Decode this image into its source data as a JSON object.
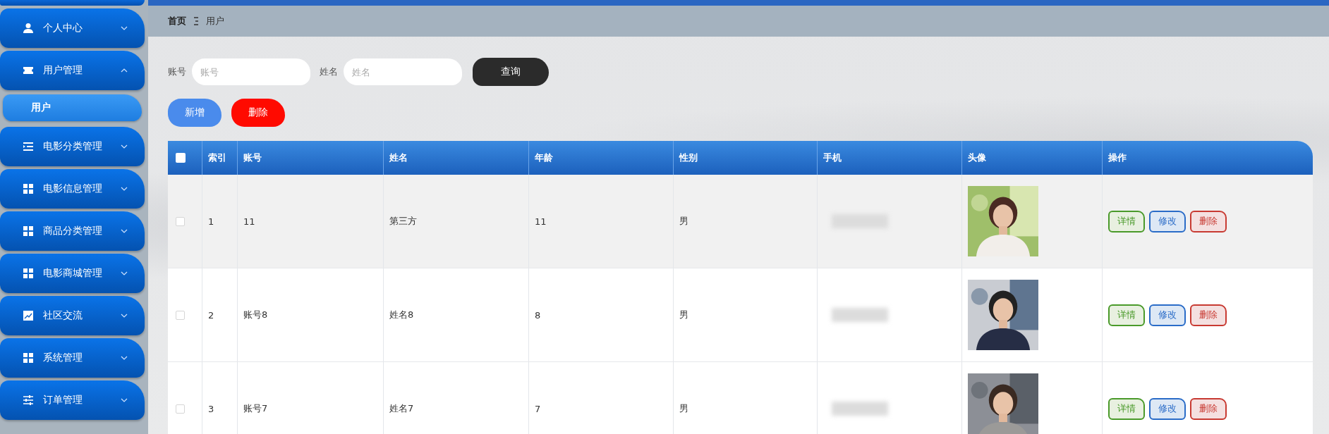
{
  "sidebar": {
    "items": [
      {
        "label": "个人中心",
        "expanded": false
      },
      {
        "label": "用户管理",
        "expanded": true,
        "children": [
          {
            "label": "用户",
            "selected": true
          }
        ]
      },
      {
        "label": "电影分类管理",
        "expanded": false
      },
      {
        "label": "电影信息管理",
        "expanded": false
      },
      {
        "label": "商品分类管理",
        "expanded": false
      },
      {
        "label": "电影商城管理",
        "expanded": false
      },
      {
        "label": "社区交流",
        "expanded": false
      },
      {
        "label": "系统管理",
        "expanded": false
      },
      {
        "label": "订单管理",
        "expanded": false
      }
    ]
  },
  "breadcrumb": [
    "首页",
    "用户"
  ],
  "search": {
    "fields": [
      {
        "label": "账号",
        "placeholder": "账号"
      },
      {
        "label": "姓名",
        "placeholder": "姓名"
      }
    ],
    "button": "查询"
  },
  "toolbar": [
    {
      "label": "新增",
      "kind": "add"
    },
    {
      "label": "删除",
      "kind": "delete"
    }
  ],
  "table": {
    "select_all": {
      "checked": false
    },
    "columns": [
      "索引",
      "账号",
      "姓名",
      "年龄",
      "性别",
      "手机",
      "头像",
      "操作"
    ],
    "rows": [
      {
        "checked": false,
        "highlighted": true,
        "index": "1",
        "account": "11",
        "name": "第三方",
        "age": "11",
        "gender": "男",
        "actions": [
          {
            "label": "详情",
            "kind": "detail"
          },
          {
            "label": "修改",
            "kind": "edit"
          },
          {
            "label": "删除",
            "kind": "delete"
          }
        ]
      },
      {
        "checked": false,
        "highlighted": false,
        "index": "2",
        "account": "账号8",
        "name": "姓名8",
        "age": "8",
        "gender": "男",
        "actions": [
          {
            "label": "详情",
            "kind": "detail"
          },
          {
            "label": "修改",
            "kind": "edit"
          },
          {
            "label": "删除",
            "kind": "delete"
          }
        ]
      },
      {
        "checked": false,
        "highlighted": false,
        "index": "3",
        "account": "账号7",
        "name": "姓名7",
        "age": "7",
        "gender": "男",
        "actions": [
          {
            "label": "详情",
            "kind": "detail"
          },
          {
            "label": "修改",
            "kind": "edit"
          },
          {
            "label": "删除",
            "kind": "delete"
          }
        ]
      }
    ]
  }
}
